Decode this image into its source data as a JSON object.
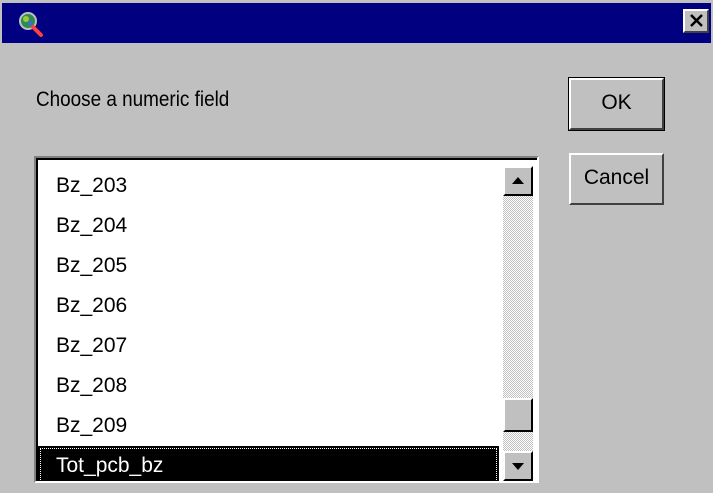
{
  "dialog": {
    "prompt": "Choose a numeric field",
    "ok_label": "OK",
    "cancel_label": "Cancel"
  },
  "titlebar": {
    "icon": "magnifier-globe-icon",
    "close_icon": "close-icon",
    "color": "#000080"
  },
  "field_list": {
    "items": [
      "Bz_203",
      "Bz_204",
      "Bz_205",
      "Bz_206",
      "Bz_207",
      "Bz_208",
      "Bz_209",
      "Tot_pcb_bz"
    ],
    "selected": "Tot_pcb_bz",
    "scroll_position": 0.95
  }
}
